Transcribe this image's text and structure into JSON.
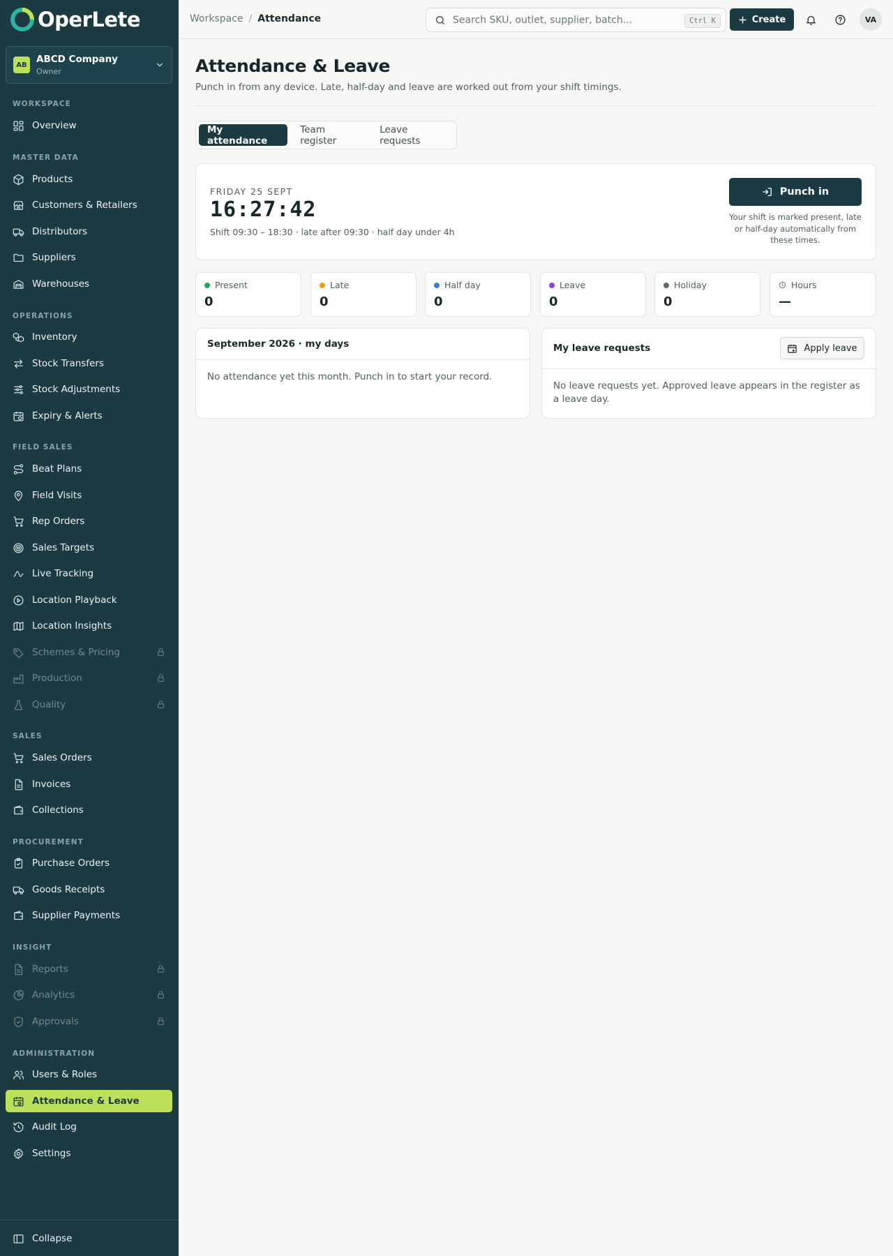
{
  "brand": {
    "name": "OperLete"
  },
  "company": {
    "badge": "AB",
    "name": "ABCD Company",
    "role": "Owner"
  },
  "sidebar": {
    "sections": {
      "workspace": "WORKSPACE",
      "master_data": "MASTER DATA",
      "operations": "OPERATIONS",
      "field_sales": "FIELD SALES",
      "sales": "SALES",
      "procurement": "PROCUREMENT",
      "insight": "INSIGHT",
      "administration": "ADMINISTRATION"
    },
    "items": {
      "overview": "Overview",
      "products": "Products",
      "customers": "Customers & Retailers",
      "distributors": "Distributors",
      "suppliers": "Suppliers",
      "warehouses": "Warehouses",
      "inventory": "Inventory",
      "stock_transfers": "Stock Transfers",
      "stock_adjustments": "Stock Adjustments",
      "expiry": "Expiry & Alerts",
      "beat_plans": "Beat Plans",
      "field_visits": "Field Visits",
      "rep_orders": "Rep Orders",
      "sales_targets": "Sales Targets",
      "live_tracking": "Live Tracking",
      "location_playback": "Location Playback",
      "location_insights": "Location Insights",
      "schemes": "Schemes & Pricing",
      "production": "Production",
      "quality": "Quality",
      "sales_orders": "Sales Orders",
      "invoices": "Invoices",
      "collections": "Collections",
      "purchase_orders": "Purchase Orders",
      "goods_receipts": "Goods Receipts",
      "supplier_payments": "Supplier Payments",
      "reports": "Reports",
      "analytics": "Analytics",
      "approvals": "Approvals",
      "users_roles": "Users & Roles",
      "attendance": "Attendance & Leave",
      "audit_log": "Audit Log",
      "settings": "Settings"
    },
    "collapse": "Collapse",
    "active_item": "Attendance & Leave",
    "active_color": "#bde05a",
    "background": "#1b3a42"
  },
  "topbar": {
    "breadcrumb": {
      "parent": "Workspace",
      "separator": "/",
      "current": "Attendance"
    },
    "search": {
      "placeholder": "Search SKU, outlet, supplier, batch...",
      "shortcut": "Ctrl K"
    },
    "create_label": "Create",
    "avatar_initials": "VA"
  },
  "page": {
    "title": "Attendance & Leave",
    "subtitle": "Punch in from any device. Late, half-day and leave are worked out from your shift timings."
  },
  "tabs": [
    {
      "label": "My attendance",
      "active": true
    },
    {
      "label": "Team register",
      "active": false
    },
    {
      "label": "Leave requests",
      "active": false
    }
  ],
  "clock": {
    "date": "FRIDAY 25 SEPT",
    "time": "16:27:42",
    "shift": "Shift 09:30 – 18:30 · late after 09:30 · half day under 4h",
    "punch_label": "Punch in",
    "note": "Your shift is marked present, late or half-day automatically from these times."
  },
  "stats": [
    {
      "label": "Present",
      "value": "0",
      "color": "#22a45d"
    },
    {
      "label": "Late",
      "value": "0",
      "color": "#f09a1a"
    },
    {
      "label": "Half day",
      "value": "0",
      "color": "#3b7be0"
    },
    {
      "label": "Leave",
      "value": "0",
      "color": "#8a45d6"
    },
    {
      "label": "Holiday",
      "value": "0",
      "color": "#5f6b70"
    },
    {
      "label": "Hours",
      "value": "—",
      "icon": "clock-icon"
    }
  ],
  "days_panel": {
    "title": "September 2026 · my days",
    "empty": "No attendance yet this month. Punch in to start your record."
  },
  "leave_panel": {
    "title": "My leave requests",
    "apply_label": "Apply leave",
    "empty": "No leave requests yet. Approved leave appears in the register as a leave day."
  }
}
